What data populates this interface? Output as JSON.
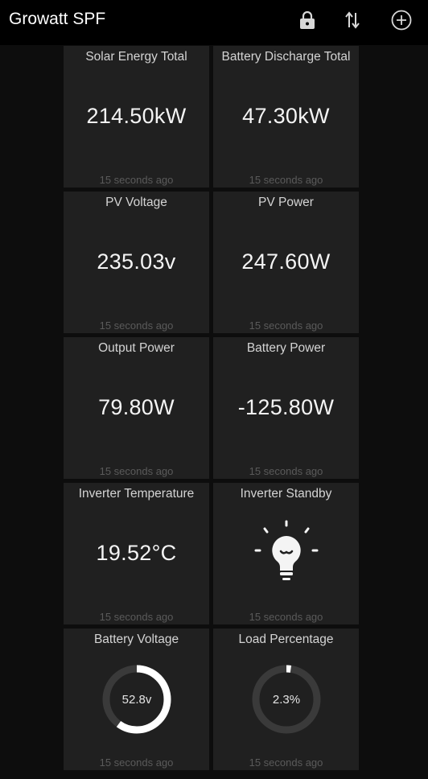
{
  "app": {
    "title": "Growatt SPF",
    "icons": [
      "lock-icon",
      "swap-vertical-icon",
      "add-circle-icon"
    ]
  },
  "cards": [
    {
      "title": "Solar Energy Total",
      "value": "214.50kW",
      "time": "15 seconds ago"
    },
    {
      "title": "Battery Discharge Total",
      "value": "47.30kW",
      "time": "15 seconds ago"
    },
    {
      "title": "PV Voltage",
      "value": "235.03v",
      "time": "15 seconds ago"
    },
    {
      "title": "PV Power",
      "value": "247.60W",
      "time": "15 seconds ago"
    },
    {
      "title": "Output Power",
      "value": "79.80W",
      "time": "15 seconds ago"
    },
    {
      "title": "Battery Power",
      "value": "-125.80W",
      "time": "15 seconds ago"
    },
    {
      "title": "Inverter Temperature",
      "value": "19.52°C",
      "time": "15 seconds ago"
    },
    {
      "title": "Inverter Standby",
      "icon": "lightbulb-icon",
      "state": "on",
      "time": "15 seconds ago"
    },
    {
      "title": "Battery Voltage",
      "gauge_label": "52.8v",
      "gauge_fraction": 0.6,
      "time": "15 seconds ago"
    },
    {
      "title": "Load Percentage",
      "gauge_label": "2.3%",
      "gauge_fraction": 0.023,
      "time": "15 seconds ago"
    }
  ],
  "colors": {
    "background": "#0d0d0d",
    "app_bar": "#000000",
    "card": "#202020",
    "gauge_track": "#3a3a3a",
    "gauge_fill": "#ffffff"
  }
}
